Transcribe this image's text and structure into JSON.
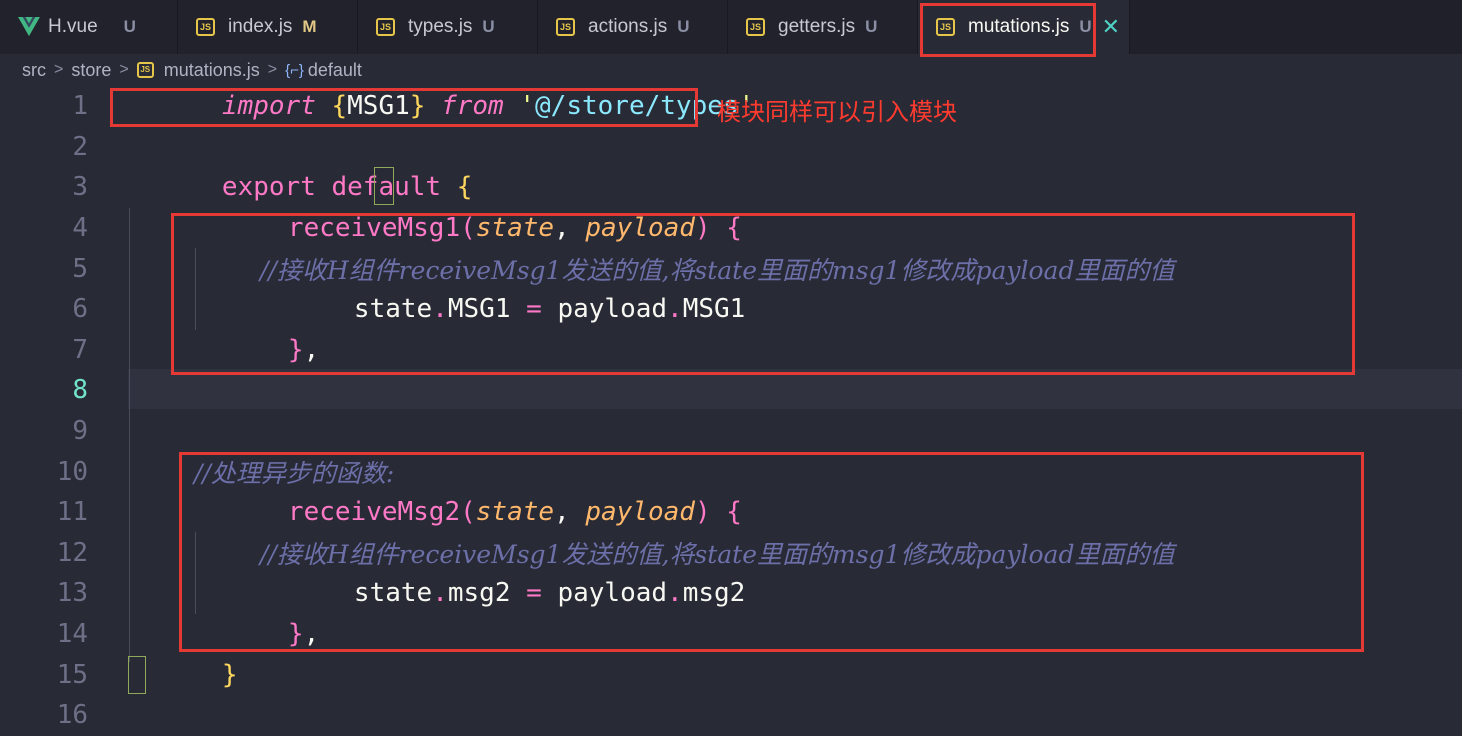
{
  "tabs": [
    {
      "icon": "vue-icon",
      "label": "H.vue",
      "status": "U"
    },
    {
      "icon": "js-file-icon",
      "icon_text": "JS",
      "label": "index.js",
      "status": "M"
    },
    {
      "icon": "js-file-icon",
      "icon_text": "JS",
      "label": "types.js",
      "status": "U"
    },
    {
      "icon": "js-file-icon",
      "icon_text": "JS",
      "label": "actions.js",
      "status": "U"
    },
    {
      "icon": "js-file-icon",
      "icon_text": "JS",
      "label": "getters.js",
      "status": "U"
    },
    {
      "icon": "js-file-icon",
      "icon_text": "JS",
      "label": "mutations.js",
      "status": "U",
      "active": true,
      "close": "✕"
    }
  ],
  "breadcrumb": {
    "parts": [
      "src",
      "store"
    ],
    "file_icon_text": "JS",
    "file": "mutations.js",
    "symbol_icon": "{⌐}",
    "symbol": "default",
    "separator": ">"
  },
  "editor": {
    "line_numbers": [
      "1",
      "2",
      "3",
      "4",
      "5",
      "6",
      "7",
      "8",
      "9",
      "10",
      "11",
      "12",
      "13",
      "14",
      "15",
      "16"
    ],
    "current_line": "8",
    "code": {
      "l1_import": "import",
      "l1_brace_open": "{",
      "l1_msg1": "MSG1",
      "l1_brace_close": "}",
      "l1_from": "from",
      "l1_quote_open": "'",
      "l1_path": "@/store/types",
      "l1_quote_close": "'",
      "l3_export": "export",
      "l3_default": "default",
      "l3_brace": "{",
      "l4_fn": "receiveMsg1",
      "l4_paren_open": "(",
      "l4_state": "state",
      "l4_comma": ",",
      "l4_payload": "payload",
      "l4_paren_close": ")",
      "l4_brace": "{",
      "l5_comment": "//接收H组件receiveMsg1发送的值,将state里面的msg1修改成payload里面的值",
      "l6_state": "state",
      "l6_dot1": ".",
      "l6_prop": "MSG1",
      "l6_eq": "=",
      "l6_payload": "payload",
      "l6_dot2": ".",
      "l6_prop2": "MSG1",
      "l7_close": "}",
      "l7_comma": ",",
      "l10_comment": "//处理异步的函数:",
      "l11_fn": "receiveMsg2",
      "l11_paren_open": "(",
      "l11_state": "state",
      "l11_comma": ",",
      "l11_payload": "payload",
      "l11_paren_close": ")",
      "l11_brace": "{",
      "l12_comment": "//接收H组件receiveMsg1发送的值,将state里面的msg1修改成payload里面的值",
      "l13_state": "state",
      "l13_dot1": ".",
      "l13_prop": "msg2",
      "l13_eq": "=",
      "l13_payload": "payload",
      "l13_dot2": ".",
      "l13_prop2": "msg2",
      "l14_close": "}",
      "l14_comma": ",",
      "l15_brace": "}"
    }
  },
  "annotation": {
    "note": "模块同样可以引入模块",
    "color": "#e53935"
  }
}
